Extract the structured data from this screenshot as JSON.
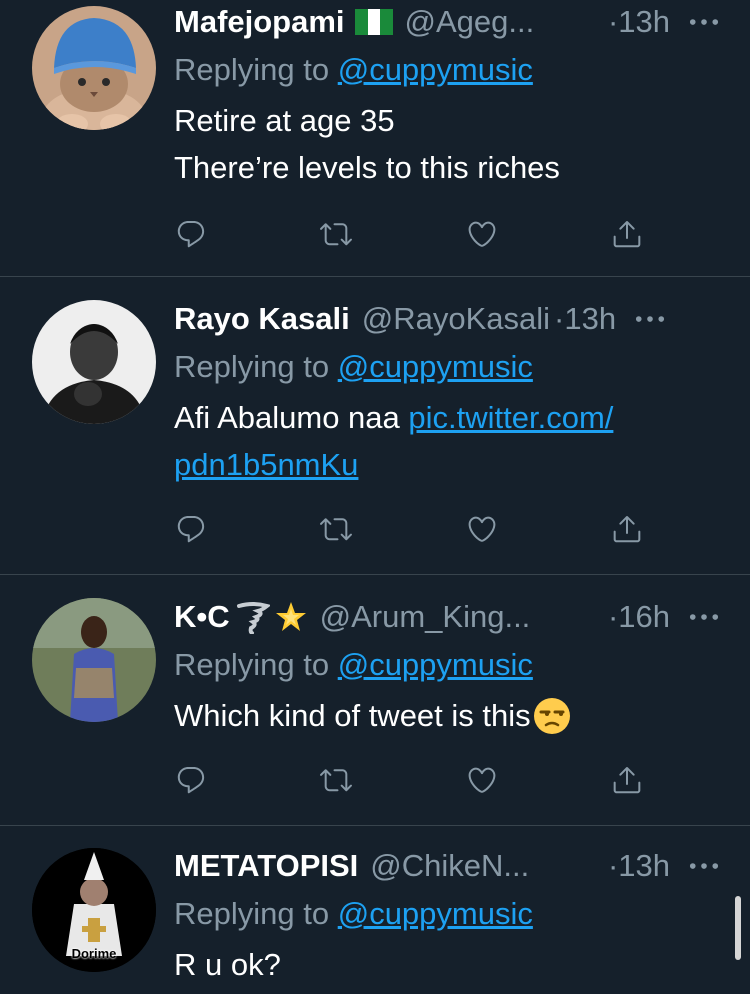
{
  "tweets": [
    {
      "name": "Mafejopami",
      "flag": "nigeria-flag-icon",
      "handle": "@Ageg...",
      "time": "·13h",
      "replying_prefix": "Replying to ",
      "replying_to": "@cuppymusic",
      "text_lines": [
        "Retire at age 35",
        "There’re levels to this riches"
      ],
      "avatar": "cat-with-blue-hat"
    },
    {
      "name": "Rayo Kasali",
      "handle": "@RayoKasali",
      "time": "·13h",
      "replying_prefix": "Replying to ",
      "replying_to": "@cuppymusic",
      "text": "Afi Abalumo naa ",
      "link_line1": "pic.twitter.com/",
      "link_line2": "pdn1b5nmKu",
      "avatar": "man-portrait-bw"
    },
    {
      "name": "K•C",
      "emojis": [
        "tornado-emoji",
        "glowing-star-emoji"
      ],
      "handle": "@Arum_King...",
      "time": "·16h",
      "replying_prefix": "Replying to ",
      "replying_to": "@cuppymusic",
      "text": "Which kind of tweet is this",
      "text_emoji": "unamused-face-emoji",
      "avatar": "man-standing-photo"
    },
    {
      "name": "METATOPISI",
      "handle": "@ChikeN...",
      "time": "·13h",
      "replying_prefix": "Replying to ",
      "replying_to": "@cuppymusic",
      "text": "R u ok?",
      "avatar_caption": "Dorime",
      "avatar": "dorime-rat"
    }
  ],
  "actions": [
    "reply-icon",
    "retweet-icon",
    "like-icon",
    "share-icon"
  ],
  "colors": {
    "background": "#15202b",
    "divider": "#38444d",
    "secondary_text": "#8899a6",
    "link": "#1da1f2"
  }
}
